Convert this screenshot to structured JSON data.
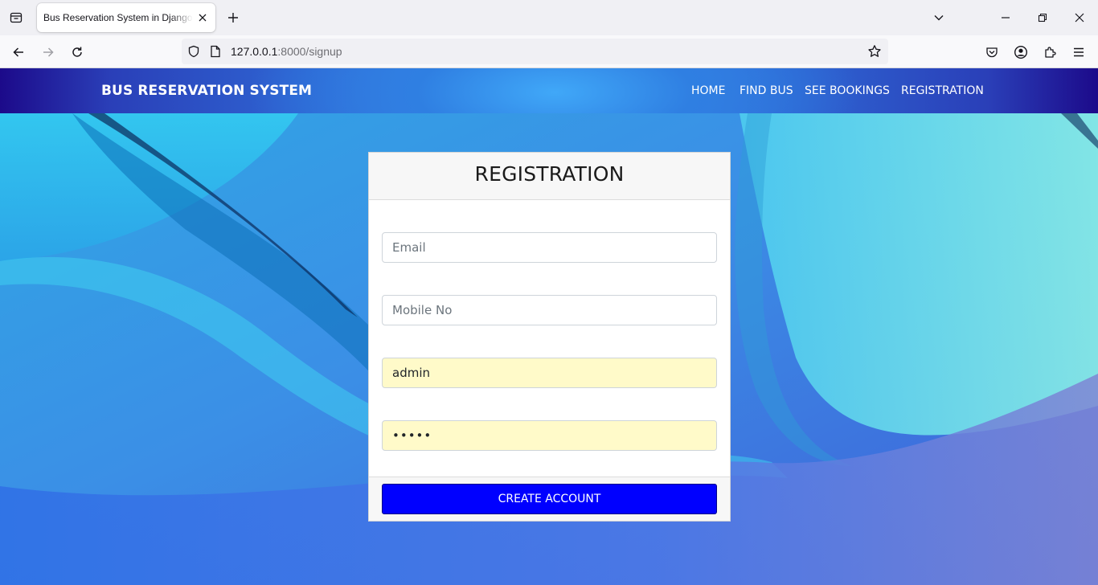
{
  "browser": {
    "tab_title": "Bus Reservation System in Django Project",
    "url_host": "127.0.0.1",
    "url_path": ":8000/signup"
  },
  "site": {
    "brand": "BUS RESERVATION SYSTEM",
    "menu": [
      "HOME",
      "FIND BUS",
      "SEE BOOKINGS",
      "REGISTRATION"
    ]
  },
  "form": {
    "title": "REGISTRATION",
    "email_placeholder": "Email",
    "mobile_placeholder": "Mobile No",
    "username_value": "admin",
    "password_value": "•••••",
    "submit_label": "CREATE ACCOUNT"
  },
  "colors": {
    "submit_button": "#0000ff",
    "autofill_bg": "#fffac9",
    "header_dark": "#1c0a8a",
    "header_light": "#3d97f2"
  }
}
